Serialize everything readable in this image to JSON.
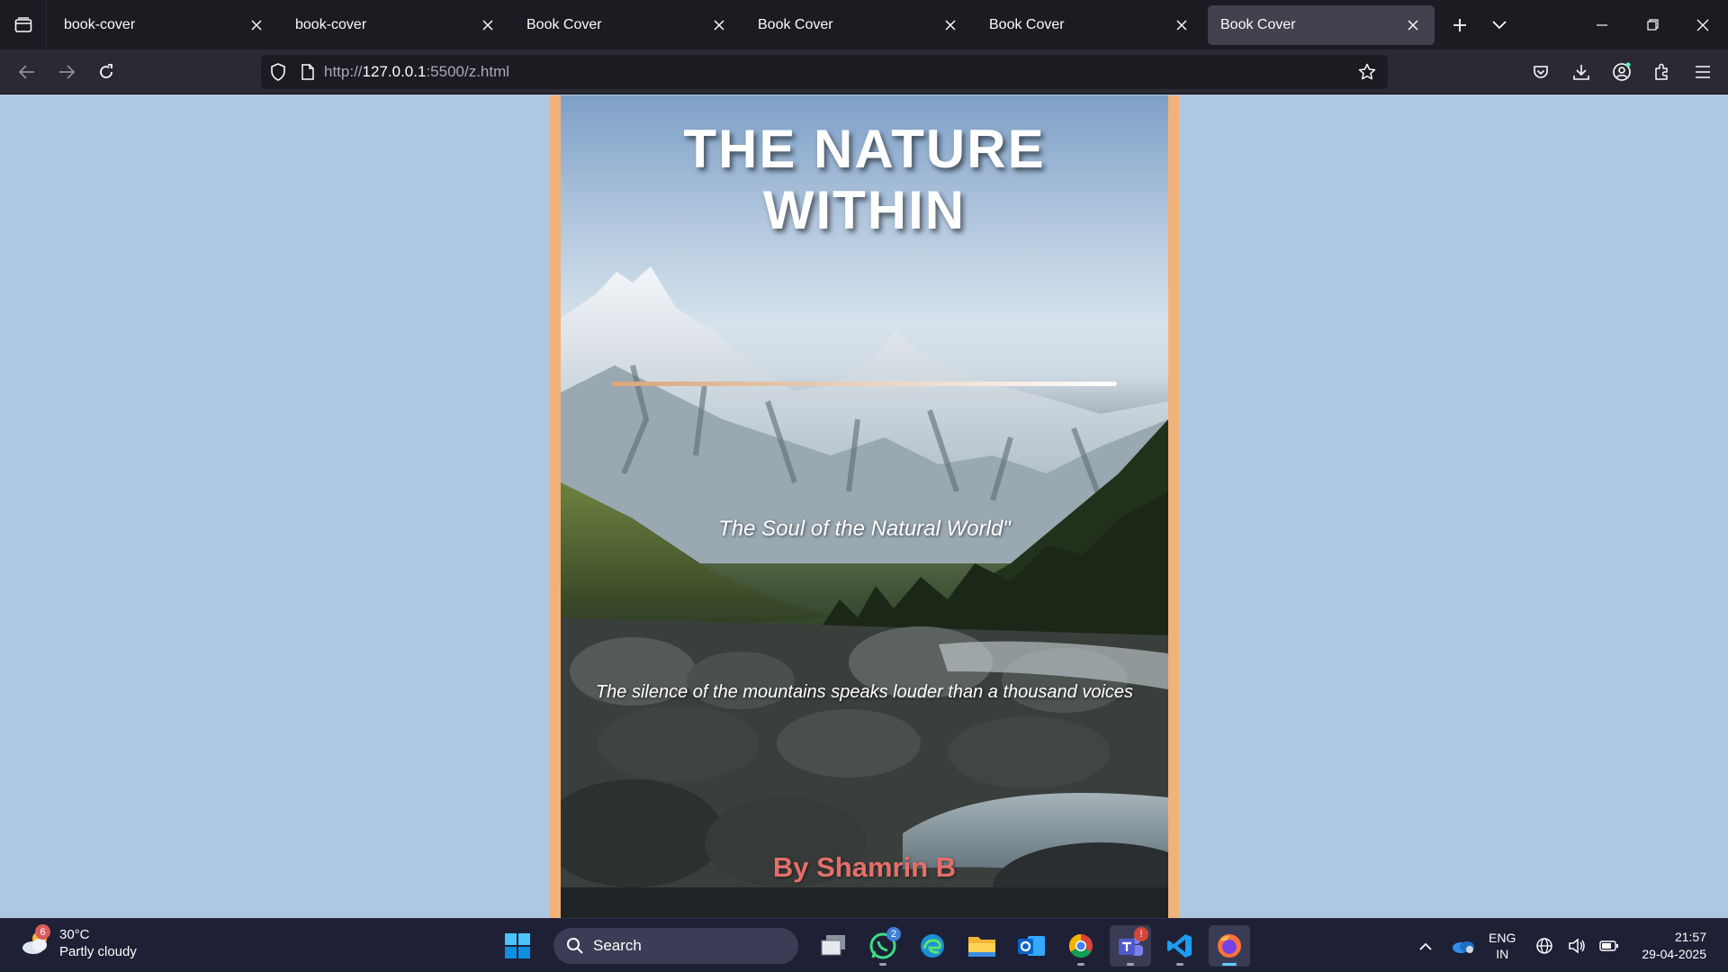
{
  "browser": {
    "tabs": [
      {
        "label": "book-cover",
        "active": false
      },
      {
        "label": "book-cover",
        "active": false
      },
      {
        "label": "Book Cover",
        "active": false
      },
      {
        "label": "Book Cover",
        "active": false
      },
      {
        "label": "Book Cover",
        "active": false
      },
      {
        "label": "Book Cover",
        "active": true
      }
    ],
    "url": {
      "prefix": "http://",
      "host": "127.0.0.1",
      "rest": ":5500/z.html"
    },
    "icons": [
      "tab-list-icon",
      "close-icon",
      "plus-icon",
      "chevron-down-icon",
      "minimize-icon",
      "restore-icon",
      "back-icon",
      "forward-icon",
      "reload-icon",
      "shield-icon",
      "page-icon",
      "star-icon",
      "pocket-icon",
      "download-icon",
      "account-icon",
      "extensions-icon",
      "menu-icon"
    ]
  },
  "book": {
    "title_line1": "THE NATURE",
    "title_line2": "WITHIN",
    "subtitle": "The Soul of the Natural World\"",
    "quote": "The silence of the mountains speaks louder than a thousand voices",
    "author": "By Shamrin B",
    "colors": {
      "frame": "#f1b27a",
      "author": "#e46f6a",
      "page_bg": "#aec8e2"
    }
  },
  "taskbar": {
    "weather": {
      "badge": "6",
      "temp": "30°C",
      "condition": "Partly cloudy"
    },
    "search_label": "Search",
    "apps": [
      {
        "name": "task-view",
        "badge": ""
      },
      {
        "name": "whatsapp",
        "badge": "2"
      },
      {
        "name": "edge",
        "badge": ""
      },
      {
        "name": "file-explorer",
        "badge": ""
      },
      {
        "name": "outlook",
        "badge": ""
      },
      {
        "name": "chrome",
        "badge": ""
      },
      {
        "name": "teams",
        "badge": "!"
      },
      {
        "name": "vscode",
        "badge": ""
      },
      {
        "name": "firefox",
        "badge": ""
      }
    ],
    "lang": {
      "line1": "ENG",
      "line2": "IN"
    },
    "clock": {
      "time": "21:57",
      "date": "29-04-2025"
    }
  }
}
